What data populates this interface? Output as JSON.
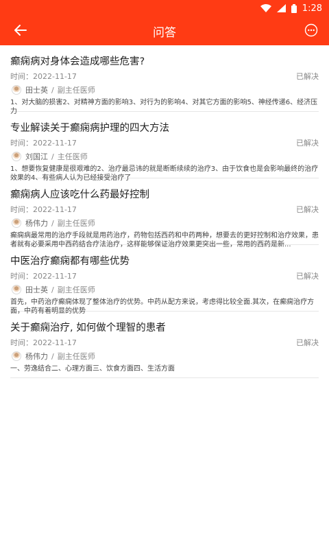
{
  "status_bar": {
    "time": "1:28",
    "icons": [
      "wifi-icon",
      "signal-icon",
      "battery-icon"
    ]
  },
  "header": {
    "title": "问答",
    "back_icon": "back-arrow-icon",
    "more_icon": "more-icon"
  },
  "colors": {
    "brand": "#ff3b14"
  },
  "items": [
    {
      "title": "癫痫病对身体会造成哪些危害?",
      "time": "时间：2022-11-17",
      "status": "已解决",
      "doctor": "田士英",
      "doctor_title": "副主任医师",
      "summary": "1、对大脑的损害2、对精神方面的影响3、对行为的影响4、对其它方面的影响5、神经传递6、经济压力"
    },
    {
      "title": "专业解读关于癫痫病护理的四大方法",
      "time": "时间：2022-11-17",
      "status": "已解决",
      "doctor": "刘国江",
      "doctor_title": "主任医师",
      "summary": "1、想要恢复健康是很艰难的2、治疗最忌讳的就是断断续续的治疗3、由于饮食也是会影响最终的治疗效果的4、有些病人认为已经接受治疗了"
    },
    {
      "title": "癫痫病人应该吃什么药最好控制",
      "time": "时间：2022-11-17",
      "status": "已解决",
      "doctor": "杨伟力",
      "doctor_title": "副主任医师",
      "summary": "癫痫病最常用的治疗手段就是用药治疗，药物包括西药和中药两种，想要去的更好控制和治疗效果，患者就有必要采用中西药结合疗法治疗，这样能够保证治疗效果更突出一些，常用的西药是新..."
    },
    {
      "title": "中医治疗癫痫都有哪些优势",
      "time": "时间：2022-11-17",
      "status": "已解决",
      "doctor": "田士英",
      "doctor_title": "副主任医师",
      "summary": "首先，中药治疗癫痫体现了整体治疗的优势。中药从配方来说，考虑得比较全面.其次，在癫痫治疗方面，中药有着明显的优势"
    },
    {
      "title": "关于癫痫治疗, 如何做个理智的患者",
      "time": "时间：2022-11-17",
      "status": "已解决",
      "doctor": "杨伟力",
      "doctor_title": "副主任医师",
      "summary": "一、劳逸结合二、心理方面三、饮食方面四、生活方面"
    }
  ]
}
